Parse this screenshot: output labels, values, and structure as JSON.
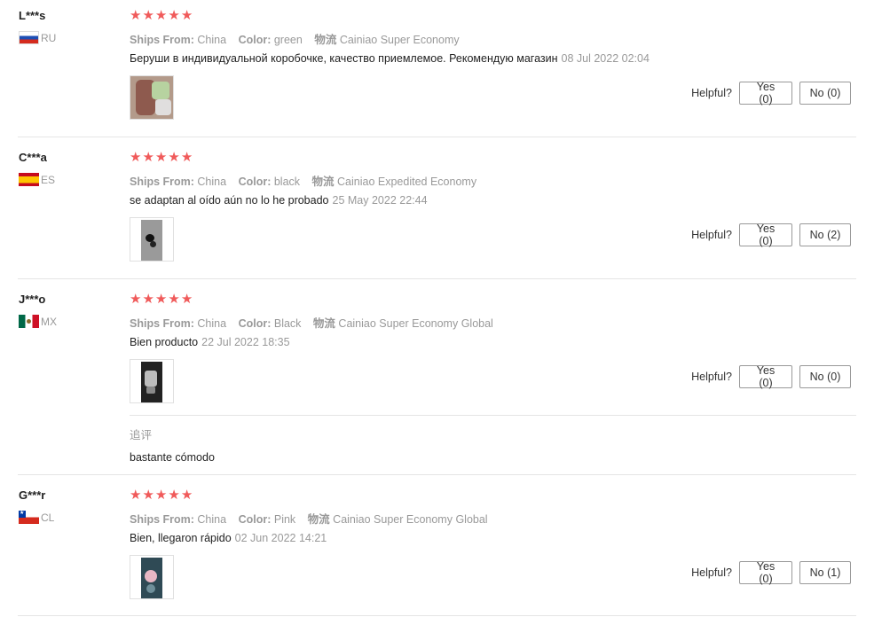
{
  "star_glyph": "★",
  "accent": "#f05a5a",
  "helpful_label": "Helpful?",
  "meta_labels": {
    "ships_from": "Ships From:",
    "color": "Color:",
    "shipping": "物流"
  },
  "reviews": [
    {
      "user": "L***s",
      "country_code": "RU",
      "flag": "ru-flag-icon",
      "rating": 5,
      "ships_from": "China",
      "color": "green",
      "shipping": "Cainiao Super Economy",
      "text": "Беруши в индивидуальной коробочке, качество приемлемое. Рекомендую магазин",
      "date": "08 Jul 2022 02:04",
      "yes": "Yes (0)",
      "no": "No (0)"
    },
    {
      "user": "C***a",
      "country_code": "ES",
      "flag": "es-flag-icon",
      "rating": 5,
      "ships_from": "China",
      "color": "black",
      "shipping": "Cainiao Expedited Economy",
      "text": "se adaptan al oído aún no lo he probado",
      "date": "25 May 2022 22:44",
      "yes": "Yes (0)",
      "no": "No (2)"
    },
    {
      "user": "J***o",
      "country_code": "MX",
      "flag": "mx-flag-icon",
      "rating": 5,
      "ships_from": "China",
      "color": "Black",
      "shipping": "Cainiao Super Economy Global",
      "text": "Bien producto",
      "date": "22 Jul 2022 18:35",
      "yes": "Yes (0)",
      "no": "No (0)",
      "followup_label": "追评",
      "followup_text": "bastante cómodo"
    },
    {
      "user": "G***r",
      "country_code": "CL",
      "flag": "cl-flag-icon",
      "rating": 5,
      "ships_from": "China",
      "color": "Pink",
      "shipping": "Cainiao Super Economy Global",
      "text": "Bien, llegaron rápido",
      "date": "02 Jun 2022 14:21",
      "yes": "Yes (0)",
      "no": "No (1)"
    }
  ]
}
